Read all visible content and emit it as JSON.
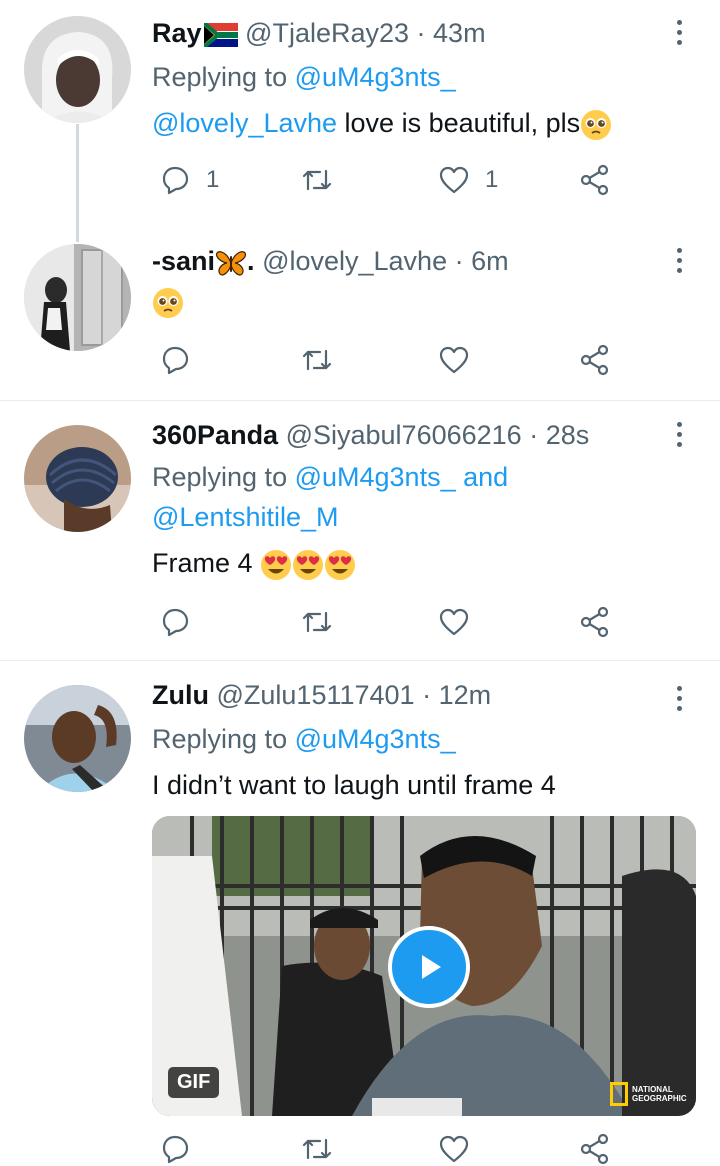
{
  "tweets": [
    {
      "name": "Ray",
      "flag_icon": "south-africa-flag-icon",
      "handle": "@TjaleRay23",
      "time": "· 43m",
      "replying_prefix": "Replying to ",
      "replying_to": "@uM4g3nts_",
      "mention": "@lovely_Lavhe",
      "text": " love is beautiful, pls",
      "emoji": "pleading-face-icon",
      "replies": "1",
      "likes": "1"
    },
    {
      "name": "-sani",
      "name_emoji": "butterfly-icon",
      "name_suffix": ".",
      "handle": "@lovely_Lavhe",
      "time": "· 6m",
      "emoji": "pleading-face-icon"
    },
    {
      "name": "360Panda",
      "handle": "@Siyabul76066216",
      "time": "· 28s",
      "replying_prefix": "Replying to ",
      "replying_to": "@uM4g3nts_ and",
      "replying_to_2": "@Lentshitile_M",
      "text": "Frame 4",
      "emoji": "heart-eyes-face-icon"
    },
    {
      "name": "Zulu",
      "handle": "@Zulu15117401",
      "time": "· 12m",
      "replying_prefix": "Replying to ",
      "replying_to": "@uM4g3nts_",
      "text": "I didn’t want to laugh until frame 4",
      "media_badge": "GIF",
      "media_watermark": "NATIONAL GEOGRAPHIC"
    }
  ],
  "colors": {
    "accent": "#1d9bf0",
    "secondary_text": "#536471",
    "divider": "#e6ecf0"
  }
}
